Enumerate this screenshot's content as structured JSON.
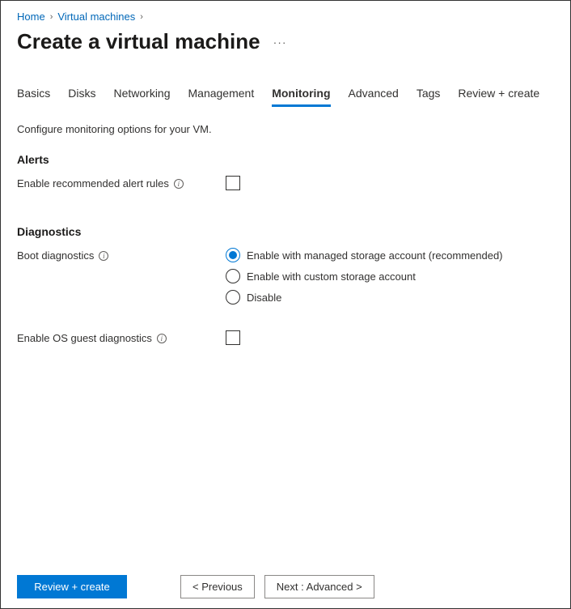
{
  "breadcrumb": {
    "home": "Home",
    "vms": "Virtual machines"
  },
  "page_title": "Create a virtual machine",
  "tabs": [
    {
      "label": "Basics",
      "active": false
    },
    {
      "label": "Disks",
      "active": false
    },
    {
      "label": "Networking",
      "active": false
    },
    {
      "label": "Management",
      "active": false
    },
    {
      "label": "Monitoring",
      "active": true
    },
    {
      "label": "Advanced",
      "active": false
    },
    {
      "label": "Tags",
      "active": false
    },
    {
      "label": "Review + create",
      "active": false
    }
  ],
  "description": "Configure monitoring options for your VM.",
  "alerts": {
    "heading": "Alerts",
    "enable_recommended_label": "Enable recommended alert rules",
    "enable_recommended_checked": false
  },
  "diagnostics": {
    "heading": "Diagnostics",
    "boot_label": "Boot diagnostics",
    "boot_options": [
      {
        "label": "Enable with managed storage account (recommended)",
        "checked": true
      },
      {
        "label": "Enable with custom storage account",
        "checked": false
      },
      {
        "label": "Disable",
        "checked": false
      }
    ],
    "os_guest_label": "Enable OS guest diagnostics",
    "os_guest_checked": false
  },
  "footer": {
    "review": "Review + create",
    "previous": "<  Previous",
    "next": "Next : Advanced  >"
  }
}
